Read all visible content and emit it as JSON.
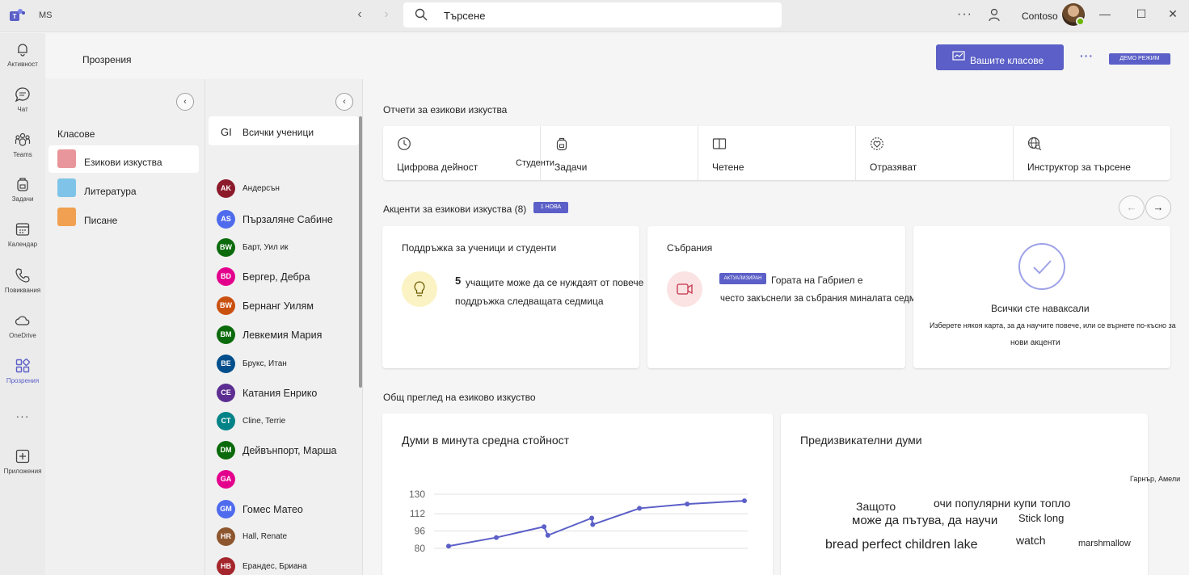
{
  "window": {
    "org": "MS",
    "user_name": "Contoso"
  },
  "search": {
    "placeholder": "Търсене"
  },
  "rail": {
    "items": [
      {
        "label": "Активност",
        "icon": "bell-icon"
      },
      {
        "label": "Чат",
        "icon": "chat-icon"
      },
      {
        "label": "Teams",
        "icon": "teams-icon"
      },
      {
        "label": "Задачи",
        "icon": "backpack-icon"
      },
      {
        "label": "Календар",
        "icon": "calendar-icon"
      },
      {
        "label": "Повиквания",
        "icon": "phone-icon"
      },
      {
        "label": "OneDrive",
        "icon": "cloud-icon"
      },
      {
        "label": "Прозрения",
        "icon": "insights-icon"
      },
      {
        "label": "",
        "icon": "more-icon"
      },
      {
        "label": "Приложения",
        "icon": "add-apps-icon"
      }
    ]
  },
  "header": {
    "title": "Прозрения",
    "classes_button": "Вашите класове",
    "more": "···",
    "demo_badge": "ДЕМО РЕЖИМ"
  },
  "classes": {
    "heading": "Класове",
    "items": [
      {
        "label": "Езикови изкуства",
        "color": "#e8969b"
      },
      {
        "label": "Литература",
        "color": "#7fc4e8"
      },
      {
        "label": "Писане",
        "color": "#f0a050"
      }
    ]
  },
  "students": {
    "all_initials": "GI",
    "all_label": "Всички ученици",
    "items": [
      {
        "initials": "AK",
        "name": "Андерсън",
        "color": "#8b1a2b"
      },
      {
        "initials": "AS",
        "name": "Пързаляне Сабине",
        "color": "#4f6bed"
      },
      {
        "initials": "BW",
        "name": "Барт, Уил ик",
        "color": "#0b6a0b"
      },
      {
        "initials": "BD",
        "name": "Бергер, Дебра",
        "color": "#e3008c"
      },
      {
        "initials": "BW",
        "name": "Бернанг Уилям",
        "color": "#ca5010"
      },
      {
        "initials": "BM",
        "name": "Левкемия Мария",
        "color": "#0b6a0b"
      },
      {
        "initials": "BE",
        "name": "Брукс, Итан",
        "color": "#004e8c"
      },
      {
        "initials": "CE",
        "name": "Катания Енрико",
        "color": "#5c2e91"
      },
      {
        "initials": "CT",
        "name": "Cline, Terrie",
        "color": "#038387"
      },
      {
        "initials": "DM",
        "name": "Дейвънпорт, Марша",
        "color": "#0b6a0b"
      },
      {
        "initials": "GA",
        "name": "",
        "color": "#e3008c"
      },
      {
        "initials": "GM",
        "name": "Гомес Матео",
        "color": "#4f6bed"
      },
      {
        "initials": "HR",
        "name": "Hall, Renate",
        "color": "#8e562e"
      },
      {
        "initials": "HB",
        "name": "Ерандес, Бриана",
        "color": "#a4262c"
      }
    ]
  },
  "reports": {
    "title": "Отчети за езикови изкуства",
    "items": [
      {
        "label": "Цифрова дейност",
        "icon": "clock-icon"
      },
      {
        "label": "Задачи",
        "icon": "backpack-icon"
      },
      {
        "label": "Четене",
        "icon": "book-icon"
      },
      {
        "label": "Отразяват",
        "icon": "heart-icon"
      },
      {
        "label": "Инструктор за търсене",
        "icon": "globe-icon"
      }
    ],
    "floating_label": "Студенти"
  },
  "highlights": {
    "title": "Акценти за езикови изкуства (8)",
    "new_badge": "1 НОВА",
    "cards": {
      "support": {
        "title": "Поддръжка за ученици и студенти",
        "count": "5",
        "line1": "учащите може да се нуждаят от повече",
        "line2": "поддръжка следващата седмица"
      },
      "meetings": {
        "title": "Събрания",
        "badge": "АКТУАЛИЗИРАН",
        "line1": "Гората на Габриел е",
        "line2": "често закъснели за събрания миналата седмица"
      },
      "caught_up": {
        "title": "Всички сте наваксали",
        "line1": "Изберете някоя карта, за да научите повече, или се върнете по-късно за",
        "line2": "нови акценти"
      }
    }
  },
  "overview": {
    "title": "Общ преглед на езиково изкуство",
    "wpm_title": "Думи в минута средна стойност",
    "challenging_title": "Предизвикателни думи",
    "corner_name": "Гарнър, Амели",
    "words": [
      {
        "text": "Защото",
        "size": 14
      },
      {
        "text": "очи популярни купи топло",
        "size": 14
      },
      {
        "text": "може да пътува, да научи",
        "size": 15
      },
      {
        "text": "Stick long",
        "size": 13
      },
      {
        "text": "bread perfect children lake",
        "size": 16
      },
      {
        "text": "watch",
        "size": 14
      },
      {
        "text": "marshmallow",
        "size": 11
      }
    ]
  },
  "chart_data": {
    "type": "line",
    "title": "Думи в минута средна стойност",
    "y_ticks": [
      80,
      96,
      112,
      130
    ],
    "ylim": [
      74,
      136
    ],
    "grid": true,
    "series": [
      {
        "values": [
          82,
          90,
          100,
          92,
          108,
          102,
          117,
          121,
          124
        ]
      }
    ],
    "x_positions": [
      0,
      1,
      2,
      2.08,
      3,
      3.02,
      4,
      5,
      6.2
    ]
  }
}
